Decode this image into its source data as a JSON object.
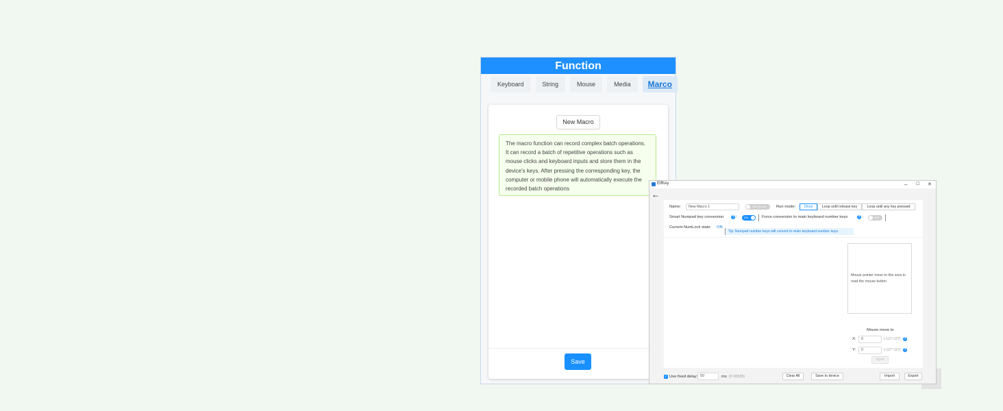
{
  "function_panel": {
    "title": "Function",
    "tabs": [
      {
        "label": "Keyboard"
      },
      {
        "label": "String"
      },
      {
        "label": "Mouse"
      },
      {
        "label": "Media"
      },
      {
        "label": "Marco",
        "active": true
      }
    ],
    "new_macro_label": "New Macro",
    "description": "The macro function can record complex batch operations. It can record a batch of repetitive operations such as mouse clicks and keyboard inputs and store them in the device's keys. After pressing the corresponding key, the computer or mobile phone will automatically execute the recorded batch operations",
    "save_label": "Save"
  },
  "elfkey_window": {
    "title": "ElfKey",
    "controls": {
      "minimize": "–",
      "maximize": "☐",
      "close": "✕"
    },
    "back_icon": "←",
    "name_label": "Name:",
    "name_value": "New Macro 1",
    "name_toggle_text": "Not Record",
    "run_mode_label": "Run mode:",
    "run_modes": [
      {
        "label": "Once",
        "selected": true
      },
      {
        "label": "Loop until release key"
      },
      {
        "label": "Loop until any key pressed"
      }
    ],
    "smart_numpad_label": "Smart Numpad key conversion",
    "smart_numpad_state": "ON",
    "force_conversion_label": "Force conversion to main keyboard number keys",
    "force_conversion_state": "OFF",
    "numlock_label": "Current NumLock state:",
    "numlock_value": "ON",
    "tip": "Tip: Numpad number keys will convert to main keyboard number keys",
    "mouse_area_text": "Mouse pointer move to this area to read the mouse button",
    "mouse_move_label": "Mouse move to",
    "x_label": "X:",
    "x_value": "0",
    "x_range": "(-127~127)",
    "y_label": "Y:",
    "y_value": "0",
    "y_range": "(-127~127)",
    "input_label": "Input",
    "fixed_delay_label": "Use fixed delay:",
    "fixed_delay_checked": true,
    "fixed_delay_value": "50",
    "delay_unit": "ms",
    "delay_range": "(0~65535)",
    "clear_all_label": "Clear All",
    "save_to_device_label": "Save to device",
    "import_label": "Import",
    "export_label": "Export"
  },
  "colors": {
    "accent": "#1890ff",
    "header_blue": "#1e90ff",
    "background": "#f1f8f1",
    "tip_green_bg": "#f6ffed"
  }
}
